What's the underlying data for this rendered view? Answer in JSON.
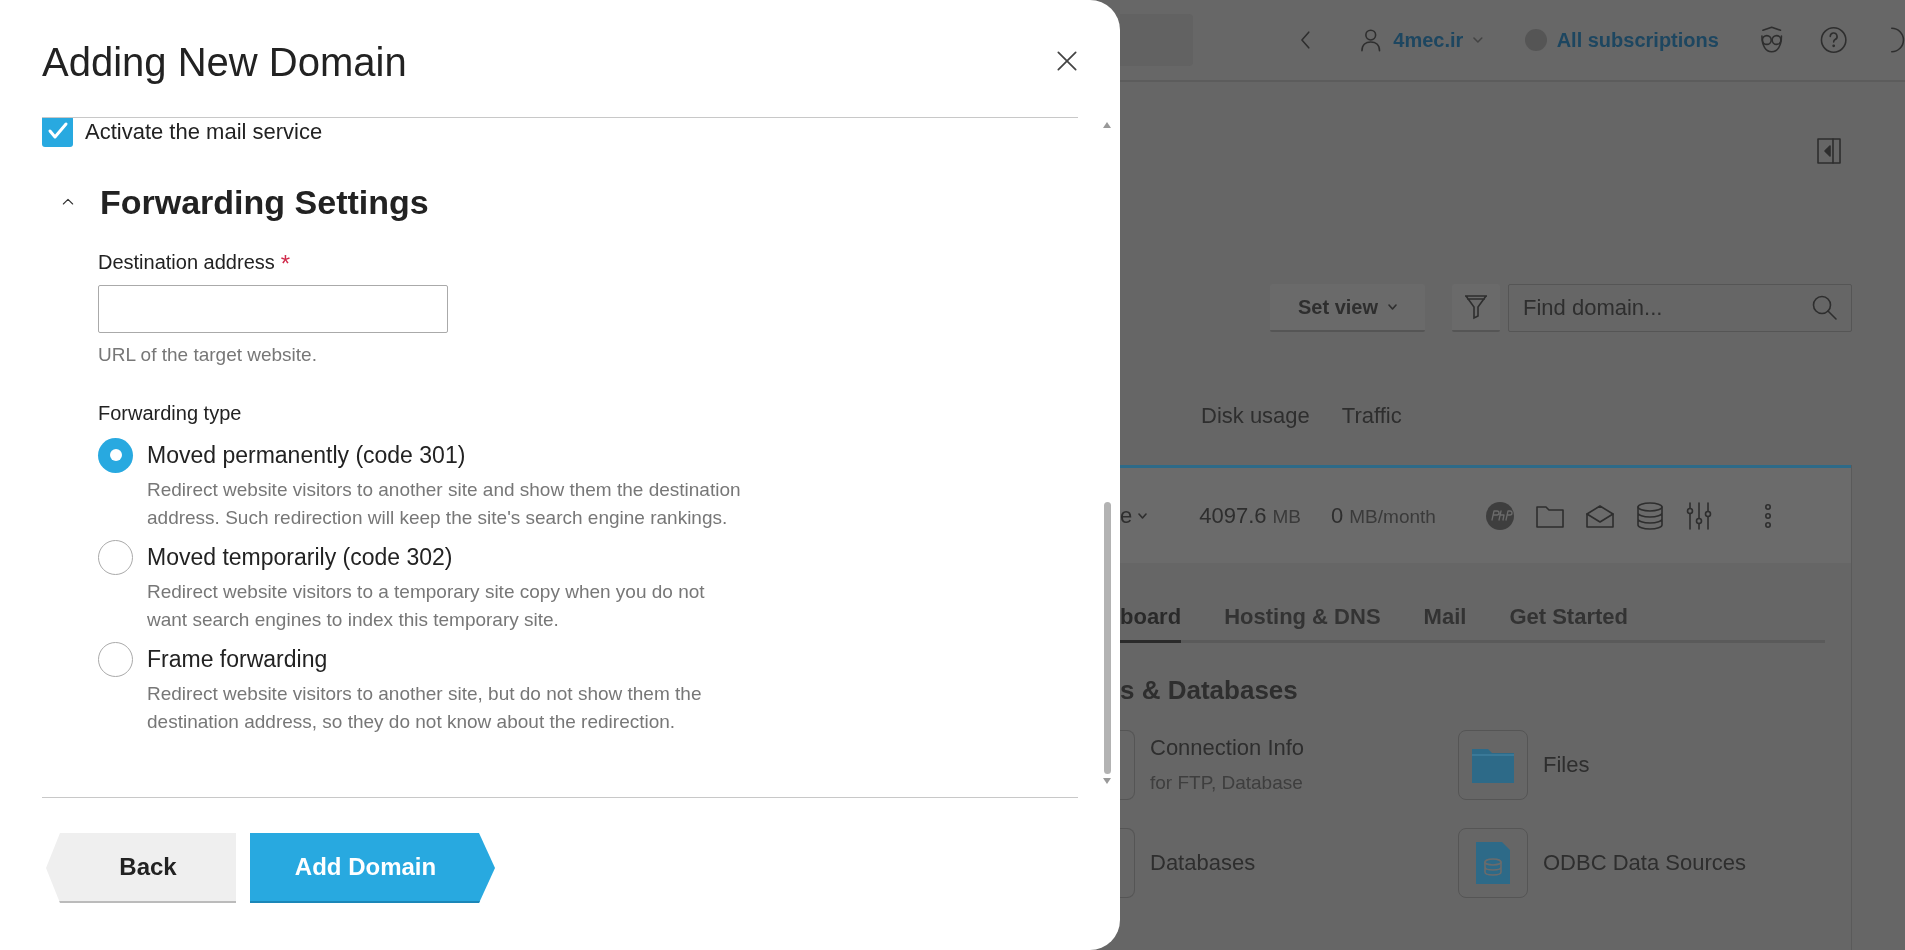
{
  "dialog": {
    "title": "Adding New Domain",
    "mail_service": {
      "label": "Activate the mail service",
      "checked": true
    },
    "section": {
      "title": "Forwarding Settings",
      "expanded": true
    },
    "destination": {
      "label": "Destination address",
      "required_mark": "*",
      "hint": "URL of the target website."
    },
    "forwarding_type": {
      "label": "Forwarding type",
      "options": [
        {
          "label": "Moved permanently (code 301)",
          "description": "Redirect website visitors to another site and show them the destination address. Such redirection will keep the site's search engine rankings.",
          "selected": true
        },
        {
          "label": "Moved temporarily (code 302)",
          "description": "Redirect website visitors to a temporary site copy when you do not want search engines to index this temporary site.",
          "selected": false
        },
        {
          "label": "Frame forwarding",
          "description": "Redirect website visitors to another site, but do not show them the destination address, so they do not know about the redirection.",
          "selected": false
        }
      ]
    },
    "buttons": [
      {
        "label": "Back",
        "kind": "back"
      },
      {
        "label": "Add Domain",
        "kind": "primary"
      }
    ]
  },
  "background": {
    "top_bar": {
      "user": "4mec.ir",
      "subscriptions": "All subscriptions"
    },
    "toolbar": {
      "set_view": "Set view",
      "search_placeholder": "Find domain..."
    },
    "columns": [
      "Disk usage",
      "Traffic"
    ],
    "row": {
      "column_1": "e",
      "disk_value": "4097.6",
      "disk_unit": "MB",
      "traffic_value": "0",
      "traffic_unit": "MB/month"
    },
    "tabs": [
      {
        "label": "board",
        "selected": true
      },
      {
        "label": "Hosting & DNS",
        "selected": false
      },
      {
        "label": "Mail",
        "selected": false
      },
      {
        "label": "Get Started",
        "selected": false
      }
    ],
    "section_title": "s & Databases",
    "tools": [
      {
        "title": "Connection Info",
        "subtitle": "for FTP, Database",
        "kind": "cut"
      },
      {
        "title": "Files",
        "kind": "folder"
      },
      {
        "title": "Databases",
        "kind": "cut"
      },
      {
        "title": "ODBC Data Sources",
        "kind": "database-file"
      }
    ]
  }
}
